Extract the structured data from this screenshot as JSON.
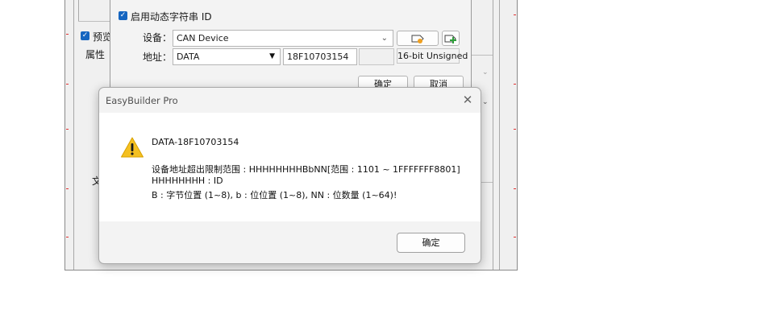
{
  "background": {
    "preview_checkbox_label": "预览",
    "properties_label": "属性",
    "text_label_fragment": "文"
  },
  "device_dialog": {
    "dynamic_string_label": "启用动态字符串 ID",
    "device_label": "设备：",
    "device_value": "CAN Device",
    "address_label": "地址：",
    "address_type_value": "DATA",
    "address_value": "18F10703154",
    "data_type": "16-bit Unsigned",
    "ok_label": "确定",
    "cancel_label": "取消"
  },
  "message_box": {
    "title": "EasyBuilder Pro",
    "close_glyph": "✕",
    "heading": "DATA-18F10703154",
    "line1": "设备地址超出限制范围 : HHHHHHHHBbNN[范围 : 1101 ~ 1FFFFFFF8801]",
    "line2": "HHHHHHHH : ID",
    "line3": "B : 字节位置 (1~8), b : 位位置 (1~8), NN : 位数量 (1~64)!",
    "ok_label": "确定"
  },
  "icons": [
    "warning-icon",
    "close-icon",
    "checkbox-checked-icon",
    "dropdown-arrow-icon",
    "tag-settings-icon",
    "add-tag-icon"
  ],
  "colors": {
    "accent": "#1565c0",
    "warning_fill": "#f4c021",
    "dialog_bg": "#f3f3f3",
    "body_bg": "#ffffff"
  }
}
